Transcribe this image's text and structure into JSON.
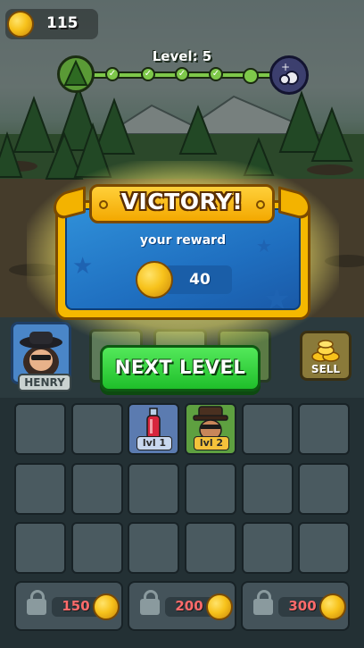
{
  "hud": {
    "coins": "115",
    "level_label": "Level: 5"
  },
  "dialog": {
    "title": "VICTORY!",
    "reward_label": "your reward",
    "reward_amount": "40"
  },
  "squad": {
    "hero_name": "HENRY",
    "sell_label": "SELL",
    "next_level_label": "NEXT LEVEL"
  },
  "inventory": {
    "items": [
      {
        "name": "potion",
        "level_label": "lvl 1"
      },
      {
        "name": "bandit",
        "level_label": "lvl 2"
      }
    ],
    "locked_slots": [
      {
        "price": "150"
      },
      {
        "price": "200"
      },
      {
        "price": "300"
      }
    ]
  },
  "colors": {
    "accent_gold": "#f5b800",
    "button_green": "#1fbf2a",
    "dialog_blue": "#1f6fc0",
    "price_red": "#ff6b6b"
  }
}
